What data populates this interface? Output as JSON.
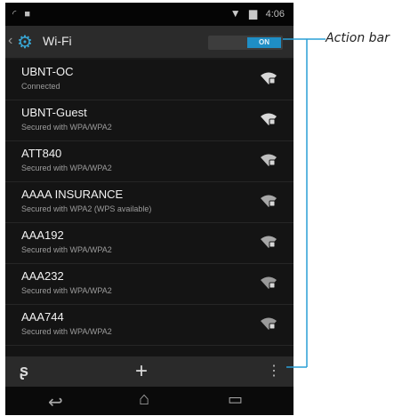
{
  "status_bar": {
    "time": "4:06",
    "icons": [
      "signal-icon",
      "notification-icon",
      "wifi-icon",
      "battery-icon"
    ]
  },
  "action_bar": {
    "title": "Wi-Fi",
    "toggle_label": "ON",
    "icon": "settings-gear-icon"
  },
  "networks": [
    {
      "name": "UBNT-OC",
      "status": "Connected"
    },
    {
      "name": "UBNT-Guest",
      "status": "Secured with WPA/WPA2"
    },
    {
      "name": "ATT840",
      "status": "Secured with WPA/WPA2"
    },
    {
      "name": "AAAA INSURANCE",
      "status": "Secured with WPA2 (WPS available)"
    },
    {
      "name": "AAA192",
      "status": "Secured with WPA/WPA2"
    },
    {
      "name": "AAA232",
      "status": "Secured with WPA/WPA2"
    },
    {
      "name": "AAA744",
      "status": "Secured with WPA/WPA2"
    }
  ],
  "bottom_bar": {
    "icons": [
      "refresh-icon",
      "add-icon",
      "overflow-menu-icon"
    ]
  },
  "nav_bar": {
    "icons": [
      "back-icon",
      "home-icon",
      "recent-apps-icon"
    ]
  },
  "callout": {
    "label": "Action bar"
  },
  "colors": {
    "accent": "#1f8ec5",
    "background": "#141414",
    "action_bar": "#2b2b2b"
  }
}
